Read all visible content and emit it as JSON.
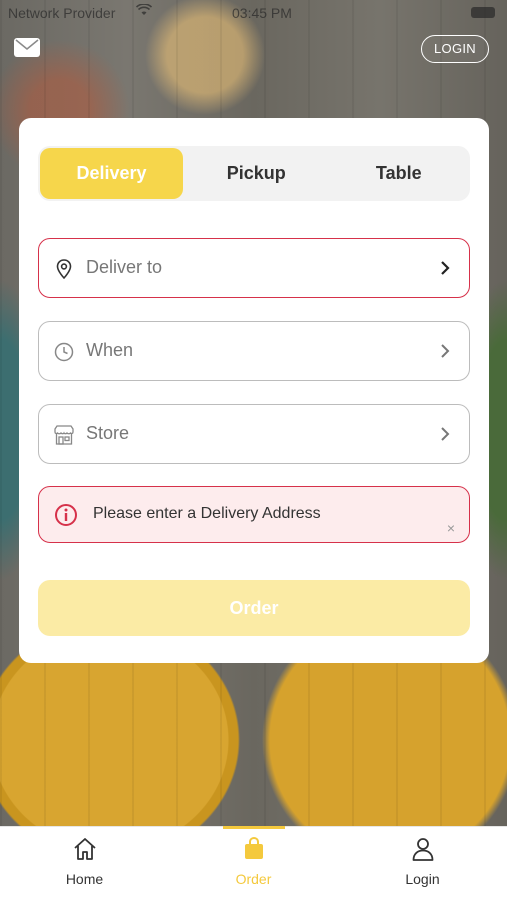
{
  "status_bar": {
    "carrier": "Network Provider",
    "time": "03:45 PM"
  },
  "header": {
    "login_label": "LOGIN"
  },
  "tabs": [
    {
      "label": "Delivery",
      "active": true
    },
    {
      "label": "Pickup",
      "active": false
    },
    {
      "label": "Table",
      "active": false
    }
  ],
  "fields": {
    "deliver_to": {
      "placeholder": "Deliver to",
      "icon": "location-pin-icon"
    },
    "when": {
      "placeholder": "When",
      "icon": "clock-icon"
    },
    "store": {
      "placeholder": "Store",
      "icon": "store-icon"
    }
  },
  "alert": {
    "message": "Please enter a Delivery Address",
    "close": "×"
  },
  "order_button": {
    "label": "Order"
  },
  "bottom_nav": [
    {
      "label": "Home",
      "icon": "home-icon",
      "active": false
    },
    {
      "label": "Order",
      "icon": "bag-icon",
      "active": true
    },
    {
      "label": "Login",
      "icon": "user-icon",
      "active": false
    }
  ],
  "colors": {
    "accent": "#f6d64b",
    "error": "#d6314a",
    "error_bg": "#fdeced",
    "disabled_button": "#fbeba5"
  }
}
